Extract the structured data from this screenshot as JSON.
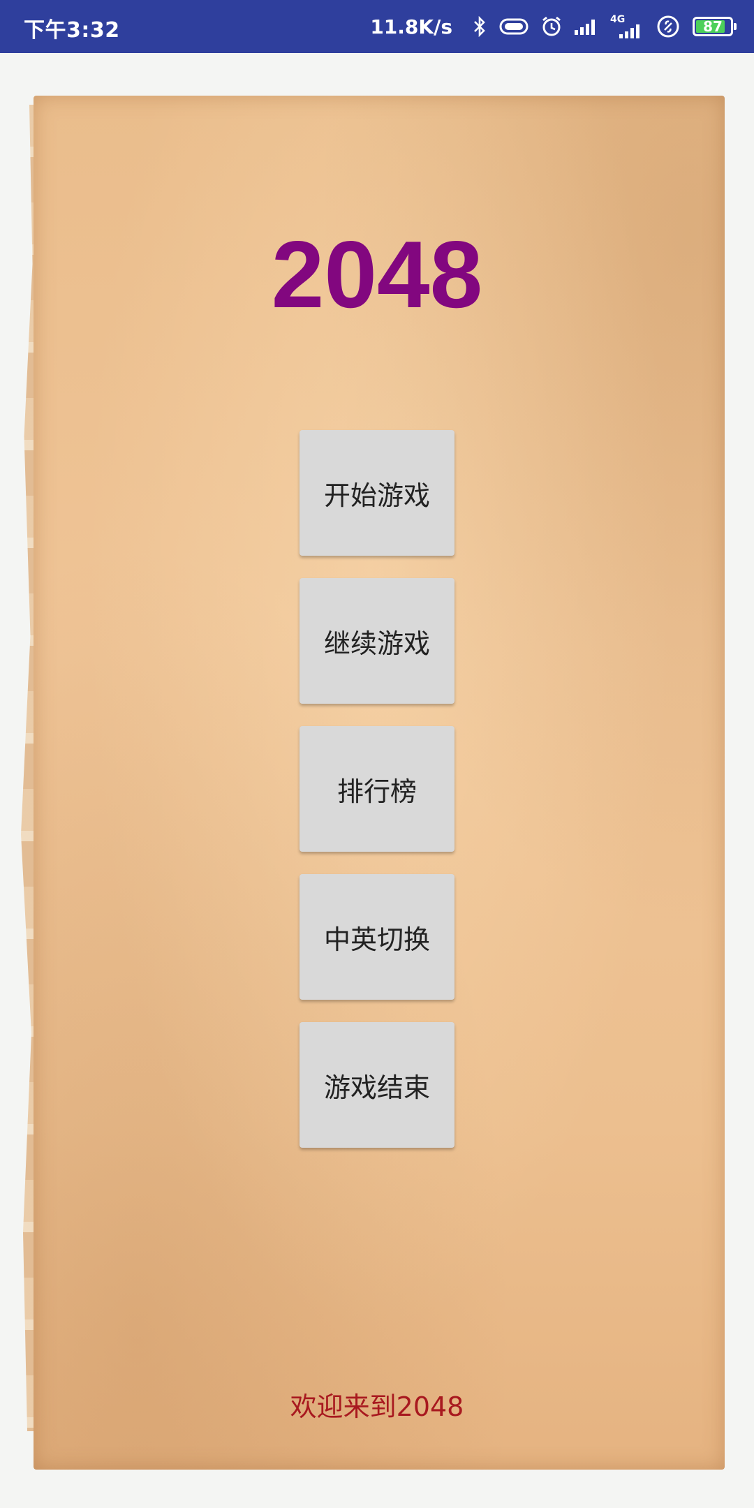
{
  "status_bar": {
    "time": "下午3:32",
    "net_speed": "11.8K/s",
    "network_type": "4G",
    "battery": "87",
    "battery_level": 0.87,
    "icons": [
      "bluetooth-icon",
      "vibrate-icon",
      "alarm-icon",
      "signal-icon",
      "signal-4g-icon",
      "hotspot-icon",
      "battery-icon"
    ]
  },
  "app": {
    "title": "2048",
    "title_color": "#82077f",
    "buttons": [
      {
        "label": "开始游戏"
      },
      {
        "label": "继续游戏"
      },
      {
        "label": "排行榜"
      },
      {
        "label": "中英切换"
      },
      {
        "label": "游戏结束"
      }
    ],
    "welcome": "欢迎来到2048",
    "welcome_color": "#a8191f",
    "status_bar_color": "#2f3f9d"
  }
}
